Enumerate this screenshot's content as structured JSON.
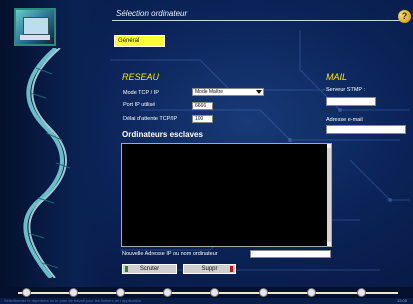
{
  "window": {
    "title": "Sélection ordinateur"
  },
  "help": {
    "label": "?"
  },
  "tabs": [
    {
      "label": "Général"
    }
  ],
  "reseau": {
    "heading": "RESEAU",
    "mode_label": "Mode TCP / IP",
    "mode_value": "Mode Maître",
    "port_label": "Port IP utilisé",
    "port_value": "6666",
    "delay_label": "Délai d'attente TCP/IP",
    "delay_value": "100"
  },
  "mail": {
    "heading": "MAIL",
    "smtp_label": "Serveur STMP :",
    "smtp_value": "",
    "email_label": "Adresse e-mail",
    "email_value": ""
  },
  "slaves": {
    "heading": "Ordinateurs esclaves",
    "items": []
  },
  "new_address": {
    "label": "Nouvelle Adresse IP ou nom ordinateur",
    "value": ""
  },
  "buttons": {
    "scan": "Scruter",
    "delete": "Suppr"
  },
  "status_bar": {
    "text": "Sélectionner le répertoire ou le plan de travail pour les fichiers de l'application",
    "time": "12:00"
  },
  "colors": {
    "accent": "#ffe600",
    "background": "#0b2358"
  }
}
